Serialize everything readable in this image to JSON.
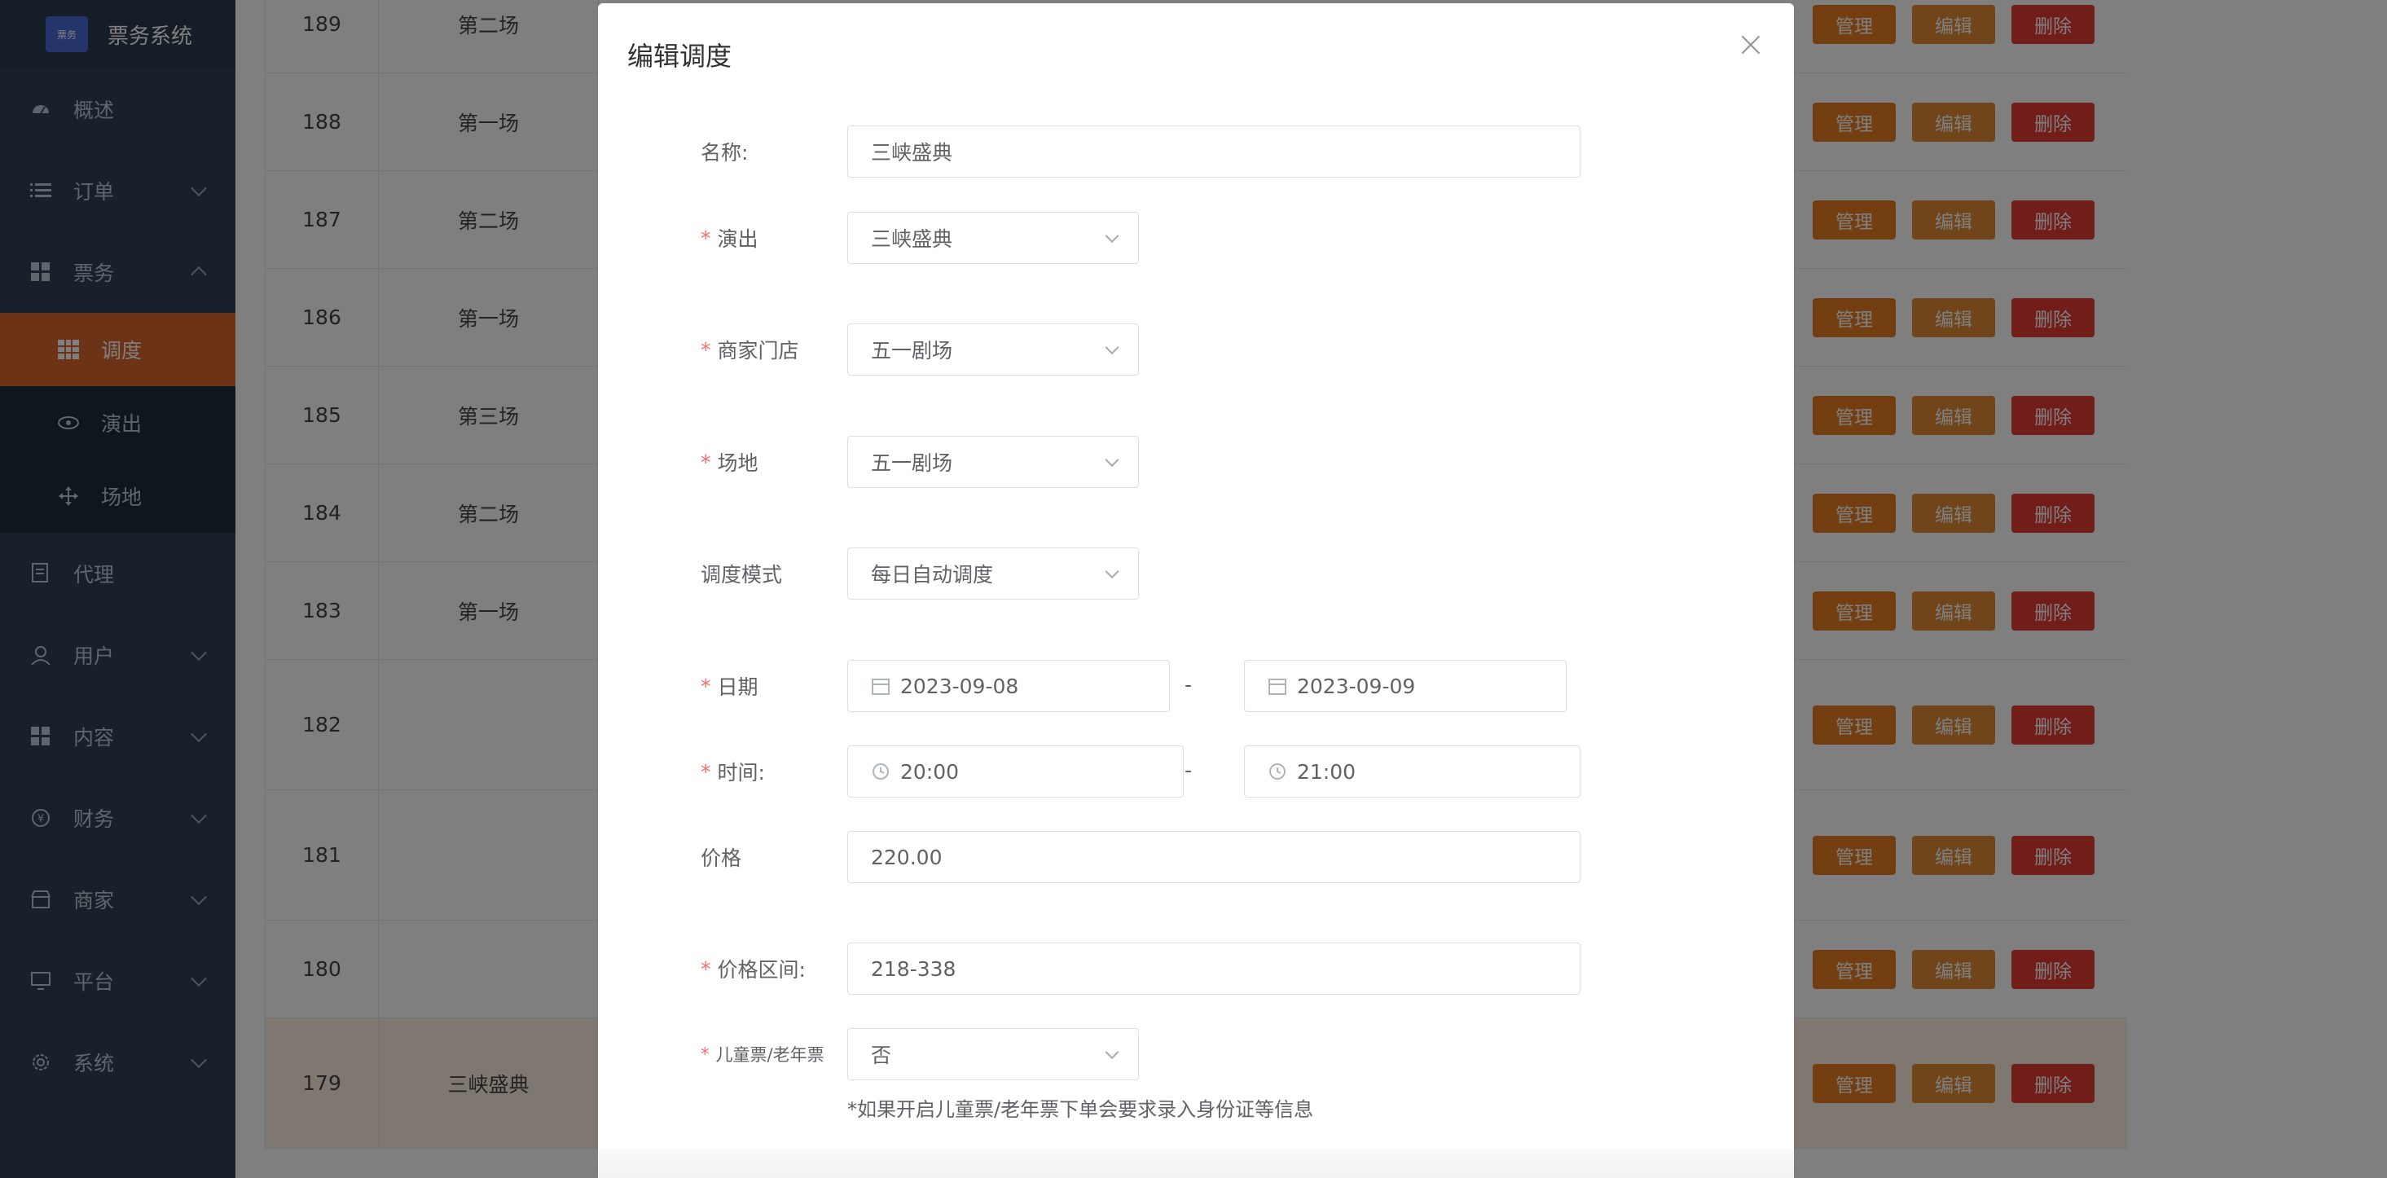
{
  "app": {
    "logo_text": "票务",
    "title": "票务系统"
  },
  "sidebar": {
    "items": [
      {
        "label": "概述",
        "icon": "dashboard-icon"
      },
      {
        "label": "订单",
        "icon": "list-icon",
        "arrow": true
      },
      {
        "label": "票务",
        "icon": "grid-icon",
        "arrow": true,
        "expanded": true,
        "children": [
          {
            "label": "调度",
            "icon": "table-icon",
            "active": true
          },
          {
            "label": "演出",
            "icon": "eye-icon"
          },
          {
            "label": "场地",
            "icon": "move-icon"
          }
        ]
      },
      {
        "label": "代理",
        "icon": "document-icon"
      },
      {
        "label": "用户",
        "icon": "user-icon",
        "arrow": true
      },
      {
        "label": "内容",
        "icon": "grid-icon",
        "arrow": true
      },
      {
        "label": "财务",
        "icon": "money-icon",
        "arrow": true
      },
      {
        "label": "商家",
        "icon": "shop-icon",
        "arrow": true
      },
      {
        "label": "平台",
        "icon": "monitor-icon",
        "arrow": true
      },
      {
        "label": "系统",
        "icon": "gear-icon",
        "arrow": true
      }
    ]
  },
  "table": {
    "ops": {
      "manage": "管理",
      "edit": "编辑",
      "delete": "删除"
    },
    "rows": [
      {
        "id": "189",
        "name": "第二场",
        "h": 120
      },
      {
        "id": "188",
        "name": "第一场",
        "h": 120
      },
      {
        "id": "187",
        "name": "第二场",
        "h": 120
      },
      {
        "id": "186",
        "name": "第一场",
        "h": 120
      },
      {
        "id": "185",
        "name": "第三场",
        "h": 120
      },
      {
        "id": "184",
        "name": "第二场",
        "h": 120
      },
      {
        "id": "183",
        "name": "第一场",
        "h": 120
      },
      {
        "id": "182",
        "name": "",
        "h": 160
      },
      {
        "id": "181",
        "name": "",
        "h": 160
      },
      {
        "id": "180",
        "name": "",
        "h": 120
      },
      {
        "id": "179",
        "name": "三峡盛典",
        "h": 160,
        "highlight": true
      }
    ]
  },
  "modal": {
    "title": "编辑调度",
    "fields": {
      "name": {
        "label": "名称:",
        "value": "三峡盛典"
      },
      "show": {
        "label": "演出",
        "value": "三峡盛典"
      },
      "store": {
        "label": "商家门店",
        "value": "五一剧场"
      },
      "venue": {
        "label": "场地",
        "value": "五一剧场"
      },
      "mode": {
        "label": "调度模式",
        "value": "每日自动调度"
      },
      "date": {
        "label": "日期",
        "start": "2023-09-08",
        "end": "2023-09-09",
        "sep": "-"
      },
      "time": {
        "label": "时间:",
        "start": "20:00",
        "end": "21:00",
        "sep": "-"
      },
      "price": {
        "label": "价格",
        "value": "220.00"
      },
      "price_range": {
        "label": "价格区间:",
        "value": "218-338"
      },
      "child_ticket": {
        "label": "儿童票/老年票",
        "value": "否"
      },
      "hint": "*如果开启儿童票/老年票下单会要求录入身份证等信息"
    }
  }
}
